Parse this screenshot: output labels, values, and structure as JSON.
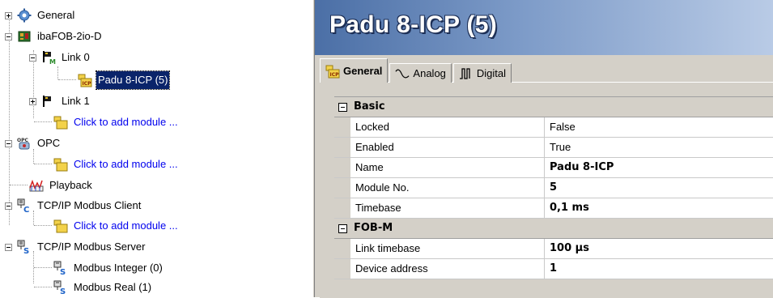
{
  "tree": {
    "items": [
      {
        "label": "General",
        "icon": "gear-icon"
      },
      {
        "label": "ibaFOB-2io-D",
        "icon": "board-icon"
      },
      {
        "label": "Link 0",
        "icon": "link-m-icon"
      },
      {
        "label": "Padu 8-ICP (5)",
        "icon": "module-icp-icon"
      },
      {
        "label": "Link 1",
        "icon": "link-icon"
      },
      {
        "label": "Click to add module ...",
        "icon": "add-module-icon"
      },
      {
        "label": "OPC",
        "icon": "opc-icon"
      },
      {
        "label": "Click to add module ...",
        "icon": "add-module-icon"
      },
      {
        "label": "Playback",
        "icon": "playback-icon"
      },
      {
        "label": "TCP/IP Modbus Client",
        "icon": "modbus-client-icon"
      },
      {
        "label": "Click to add module ...",
        "icon": "add-module-icon"
      },
      {
        "label": "TCP/IP Modbus Server",
        "icon": "modbus-server-icon"
      },
      {
        "label": "Modbus Integer (0)",
        "icon": "modbus-s-icon"
      },
      {
        "label": "Modbus Real (1)",
        "icon": "modbus-s-icon"
      }
    ]
  },
  "panel": {
    "title": "Padu 8-ICP (5)",
    "tabs": [
      {
        "label": "General",
        "icon": "module-icp-icon",
        "active": true
      },
      {
        "label": "Analog",
        "icon": "analog-wave-icon",
        "active": false
      },
      {
        "label": "Digital",
        "icon": "digital-wave-icon",
        "active": false
      }
    ],
    "categories": [
      {
        "name": "Basic",
        "props": [
          {
            "name": "Locked",
            "value": "False"
          },
          {
            "name": "Enabled",
            "value": "True"
          },
          {
            "name": "Name",
            "value": "Padu 8-ICP"
          },
          {
            "name": "Module No.",
            "value": "5"
          },
          {
            "name": "Timebase",
            "value": "0,1 ms"
          }
        ]
      },
      {
        "name": "FOB-M",
        "props": [
          {
            "name": "Link timebase",
            "value": "100 µs"
          },
          {
            "name": "Device address",
            "value": "1"
          }
        ]
      }
    ]
  },
  "colors": {
    "selection": "#0a246a",
    "link": "#0000ee",
    "title_gradient_start": "#4b6fa6",
    "title_gradient_end": "#b9cbe6",
    "panel_bg": "#d4d0c8"
  }
}
